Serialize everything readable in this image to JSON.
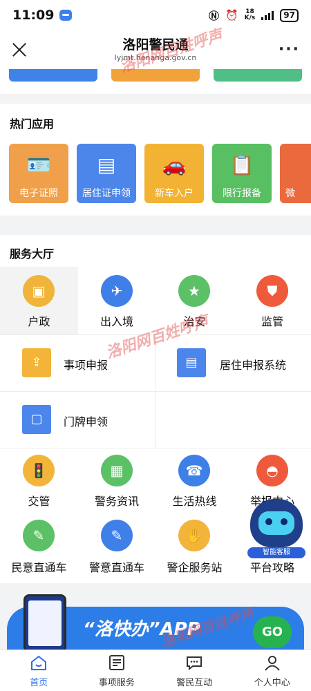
{
  "status_bar": {
    "time": "11:09",
    "net_speed_value": "18",
    "net_speed_unit": "K/s",
    "battery": "97"
  },
  "title_bar": {
    "title": "洛阳警民通",
    "url": "lyjmt.henanga.gov.cn"
  },
  "hot_apps": {
    "title": "热门应用",
    "items": [
      {
        "label": "电子证照",
        "icon": "id-card-icon",
        "color": "#f0a04a"
      },
      {
        "label": "居住证申领",
        "icon": "residence-card-icon",
        "color": "#4d86ea"
      },
      {
        "label": "新车入户",
        "icon": "car-icon",
        "color": "#f2b233"
      },
      {
        "label": "限行报备",
        "icon": "clipboard-icon",
        "color": "#58bf63"
      },
      {
        "label": "微",
        "icon": "more-app-icon",
        "color": "#ea6a3e"
      }
    ]
  },
  "service_hall": {
    "title": "服务大厅",
    "categories": [
      {
        "label": "户政",
        "icon": "household-icon",
        "color": "#f0b43a"
      },
      {
        "label": "出入境",
        "icon": "plane-globe-icon",
        "color": "#3f7fe8"
      },
      {
        "label": "治安",
        "icon": "police-badge-icon",
        "color": "#5cc066"
      },
      {
        "label": "监管",
        "icon": "shield-icon",
        "color": "#ef5a3c"
      }
    ],
    "sub_items": [
      {
        "label": "事项申报",
        "icon": "document-upload-icon",
        "color": "#f2b53a"
      },
      {
        "label": "居住申报系统",
        "icon": "residence-card-icon",
        "color": "#4d86ea"
      },
      {
        "label": "门牌申领",
        "icon": "door-plate-icon",
        "color": "#4d86ea"
      }
    ],
    "row1": [
      {
        "label": "交管",
        "icon": "traffic-light-icon",
        "color": "#f2b53a"
      },
      {
        "label": "警务资讯",
        "icon": "newspaper-icon",
        "color": "#5cc066"
      },
      {
        "label": "生活热线",
        "icon": "phone-icon",
        "color": "#3f7fe8"
      },
      {
        "label": "举报中心",
        "icon": "alarm-light-icon",
        "color": "#ef5a3c"
      }
    ],
    "row2": [
      {
        "label": "民意直通车",
        "icon": "public-opinion-icon",
        "color": "#5cc066"
      },
      {
        "label": "警意直通车",
        "icon": "police-opinion-icon",
        "color": "#3f7fe8"
      },
      {
        "label": "警企服务站",
        "icon": "handshake-icon",
        "color": "#f2b53a"
      },
      {
        "label": "平台攻略",
        "icon": "guide-icon",
        "color": "#ef5a3c"
      }
    ]
  },
  "chat_bot": {
    "label": "智能客服"
  },
  "promo": {
    "text": "“洛快办”APP",
    "go": "GO"
  },
  "bottom_nav": [
    {
      "label": "首页",
      "icon": "home-icon",
      "active": true
    },
    {
      "label": "事项服务",
      "icon": "service-list-icon",
      "active": false
    },
    {
      "label": "警民互动",
      "icon": "chat-icon",
      "active": false
    },
    {
      "label": "个人中心",
      "icon": "user-icon",
      "active": false
    }
  ],
  "watermark": {
    "site": "洛阳网",
    "column": "百姓呼声"
  },
  "colors": {
    "accent": "#2c6cf0",
    "page_bg": "#f2f3f5",
    "promo_bg": "#2c7de8"
  }
}
